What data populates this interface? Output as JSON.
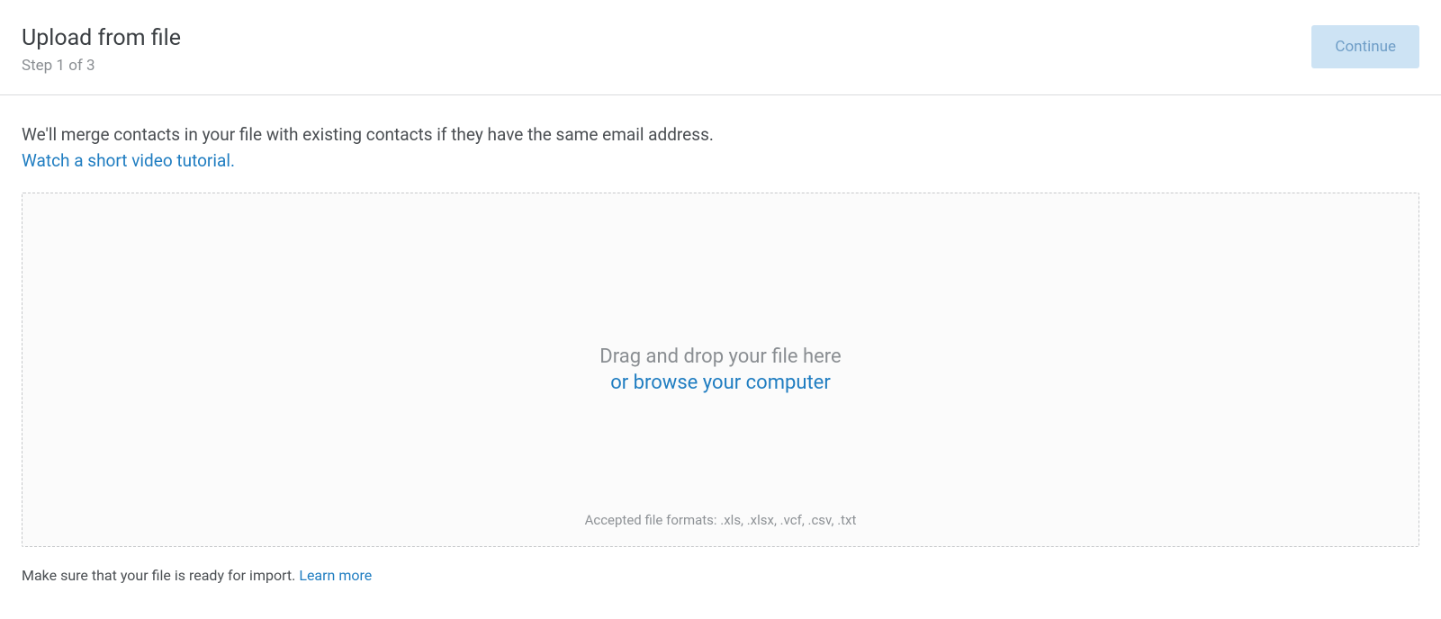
{
  "header": {
    "title": "Upload from file",
    "step": "Step 1 of 3",
    "continue_label": "Continue"
  },
  "content": {
    "intro_text": "We'll merge contacts in your file with existing contacts if they have the same email address.",
    "video_link_text": "Watch a short video tutorial.",
    "dropzone": {
      "drag_text": "Drag and drop your file here",
      "browse_text": "or browse your computer",
      "accepted_formats": "Accepted file formats: .xls, .xlsx, .vcf, .csv, .txt"
    },
    "footer_note": "Make sure that your file is ready for import. ",
    "learn_more_text": "Learn more"
  }
}
